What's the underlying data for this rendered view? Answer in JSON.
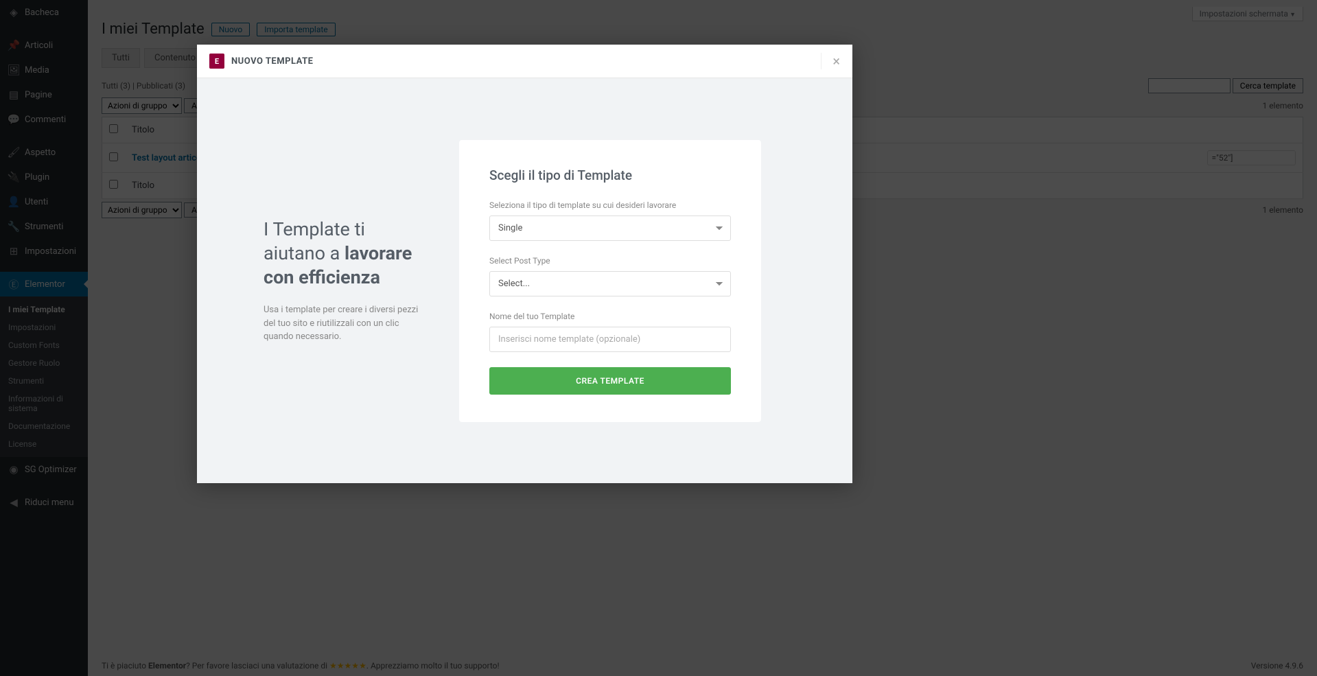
{
  "sidebar": {
    "items": [
      {
        "label": "Bacheca",
        "icon": "⌂"
      },
      {
        "label": "Articoli",
        "icon": "✎"
      },
      {
        "label": "Media",
        "icon": "⧉"
      },
      {
        "label": "Pagine",
        "icon": "▤"
      },
      {
        "label": "Commenti",
        "icon": "💬"
      },
      {
        "label": "Aspetto",
        "icon": "✦"
      },
      {
        "label": "Plugin",
        "icon": "⚡"
      },
      {
        "label": "Utenti",
        "icon": "👤"
      },
      {
        "label": "Strumenti",
        "icon": "🔧"
      },
      {
        "label": "Impostazioni",
        "icon": "⊞"
      },
      {
        "label": "Elementor",
        "icon": "Ⓔ"
      },
      {
        "label": "SG Optimizer",
        "icon": "◉"
      },
      {
        "label": "Riduci menu",
        "icon": "◀"
      }
    ],
    "submenu": [
      {
        "label": "I miei Template"
      },
      {
        "label": "Impostazioni"
      },
      {
        "label": "Custom Fonts"
      },
      {
        "label": "Gestore Ruolo"
      },
      {
        "label": "Strumenti"
      },
      {
        "label": "Informazioni di sistema"
      },
      {
        "label": "Documentazione"
      },
      {
        "label": "License"
      }
    ]
  },
  "page": {
    "title": "I miei Template",
    "btn_new": "Nuovo",
    "btn_import": "Importa template",
    "screen_options": "Impostazioni schermata",
    "tabs": [
      "Tutti",
      "Contenuto"
    ],
    "filter_all": "Tutti (3)",
    "filter_published": "Pubblicati (3)",
    "search_btn": "Cerca template",
    "bulk_label": "Azioni di gruppo",
    "apply_label": "Applica",
    "count_label": "1 elemento",
    "col_title": "Titolo",
    "row_title": "Test layout articolo",
    "shortcode_value": "=\"52\"]"
  },
  "modal": {
    "title": "NUOVO TEMPLATE",
    "heading_light": "I Template ti aiutano a ",
    "heading_bold": "lavorare con efficienza",
    "description": "Usa i template per creare i diversi pezzi del tuo sito e riutilizzali con un clic quando necessario.",
    "form_title": "Scegli il tipo di Template",
    "type_label": "Seleziona il tipo di template su cui desideri lavorare",
    "type_value": "Single",
    "post_type_label": "Select Post Type",
    "post_type_value": "Select...",
    "name_label": "Nome del tuo Template",
    "name_placeholder": "Inserisci nome template (opzionale)",
    "create_btn": "CREA TEMPLATE"
  },
  "footer": {
    "text_a": "Ti è piaciuto ",
    "text_b": "Elementor",
    "text_c": "? Per favore lasciaci una valutazione di ",
    "stars": "★★★★★",
    "text_d": ". Apprezziamo molto il tuo supporto!",
    "version": "Versione 4.9.6"
  }
}
